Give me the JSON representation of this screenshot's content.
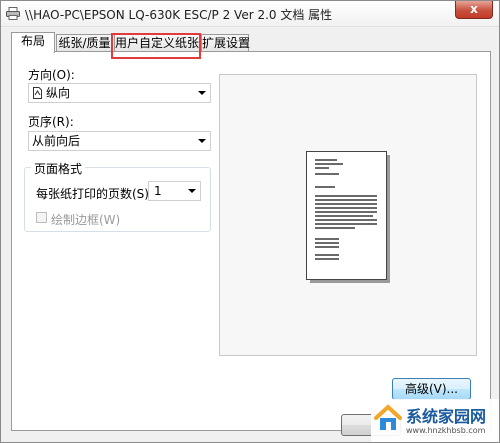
{
  "window": {
    "title": "\\\\HAO-PC\\EPSON LQ-630K ESC/P 2 Ver 2.0 文档 属性",
    "close_label": "x"
  },
  "tabs": [
    {
      "label": "布局",
      "active": true
    },
    {
      "label": "纸张/质量",
      "active": false
    },
    {
      "label": "用户自定义纸张",
      "active": false
    },
    {
      "label": "扩展设置",
      "active": false
    }
  ],
  "orientation": {
    "label": "方向(O):",
    "value": "纵向",
    "icon": "portrait-page-icon"
  },
  "page_order": {
    "label": "页序(R):",
    "value": "从前向后"
  },
  "page_format": {
    "group_title": "页面格式",
    "pages_per_sheet_label": "每张纸打印的页数(S)",
    "pages_per_sheet_value": "1",
    "draw_borders_label": "绘制边框(W)",
    "draw_borders_checked": false
  },
  "buttons": {
    "advanced": "高级(V)..."
  },
  "watermark": {
    "text": "系统家园网",
    "url": "www.hnzkhbsb.com"
  },
  "colors": {
    "highlight": "#e03a3a",
    "close": "#c7523e",
    "watermark_text": "#1a5a9e"
  }
}
